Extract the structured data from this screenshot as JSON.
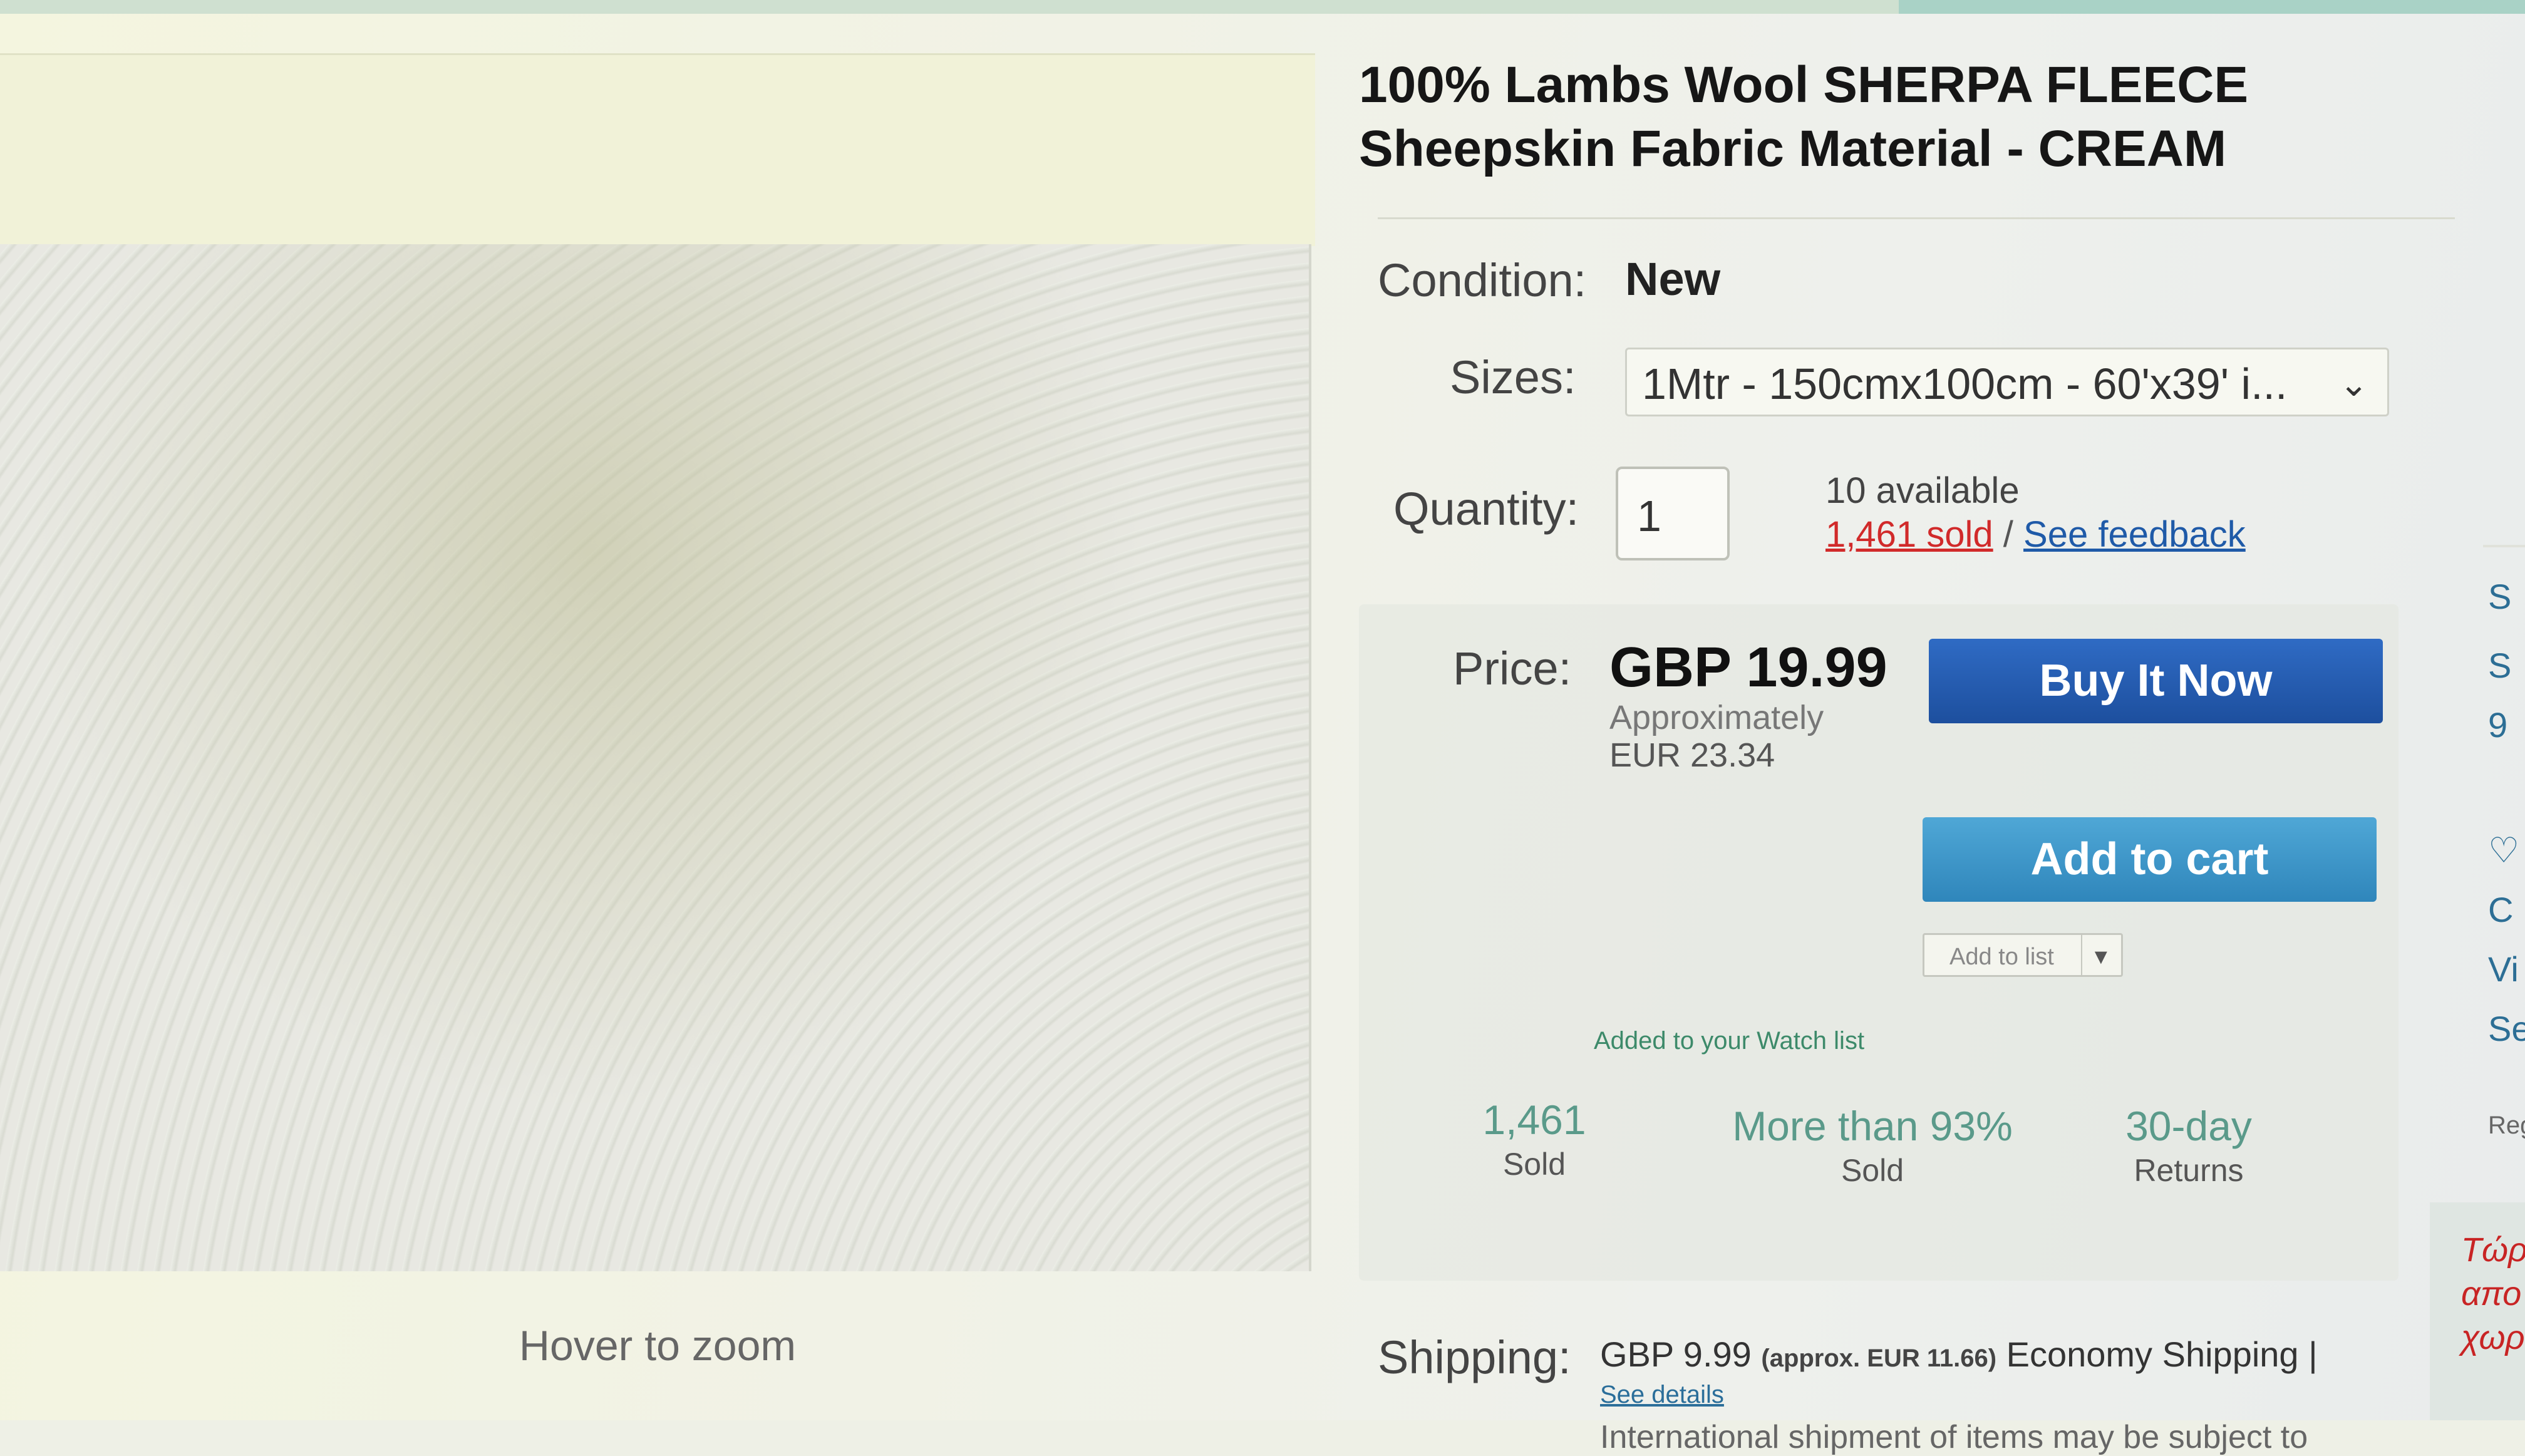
{
  "image": {
    "hover_label": "Hover to zoom"
  },
  "listing": {
    "title": "100% Lambs Wool SHERPA FLEECE Sheepskin Fabric Material - CREAM",
    "condition_label": "Condition:",
    "condition_value": "New",
    "sizes_label": "Sizes:",
    "sizes_selected": "1Mtr - 150cmx100cm - 60'x39' i...",
    "quantity_label": "Quantity:",
    "quantity_value": "1",
    "available_text": "10 available",
    "sold_link": "1,461 sold",
    "separator": "/",
    "feedback_link": "See feedback"
  },
  "price": {
    "label": "Price:",
    "value": "GBP 19.99",
    "approx_label": "Approximately",
    "approx_value": "EUR 23.34"
  },
  "actions": {
    "buy_now": "Buy It Now",
    "add_to_cart": "Add to cart",
    "add_to_list": "Add to list",
    "watch_note": "Added to your Watch list"
  },
  "stats": [
    {
      "value": "1,461",
      "caption": "Sold"
    },
    {
      "value": "More than 93%",
      "caption": "Sold"
    },
    {
      "value": "30-day",
      "caption": "Returns"
    }
  ],
  "shipping": {
    "label": "Shipping:",
    "cost": "GBP 9.99",
    "approx": "(approx. EUR 11.66)",
    "method": "Economy Shipping |",
    "see_details": "See details",
    "intl_note": "International shipment of items may be subject to"
  },
  "sidebar": {
    "items": [
      "S",
      "S",
      "9",
      "C",
      "Vi",
      "Se",
      "Reg"
    ],
    "promo_lines": [
      "Τώρ",
      "απο",
      "χωρ"
    ]
  },
  "colors": {
    "buy_button": "#1d4f9e",
    "cart_button": "#2f86bb",
    "sold_link": "#d12a2a",
    "link": "#1f5aa8"
  }
}
